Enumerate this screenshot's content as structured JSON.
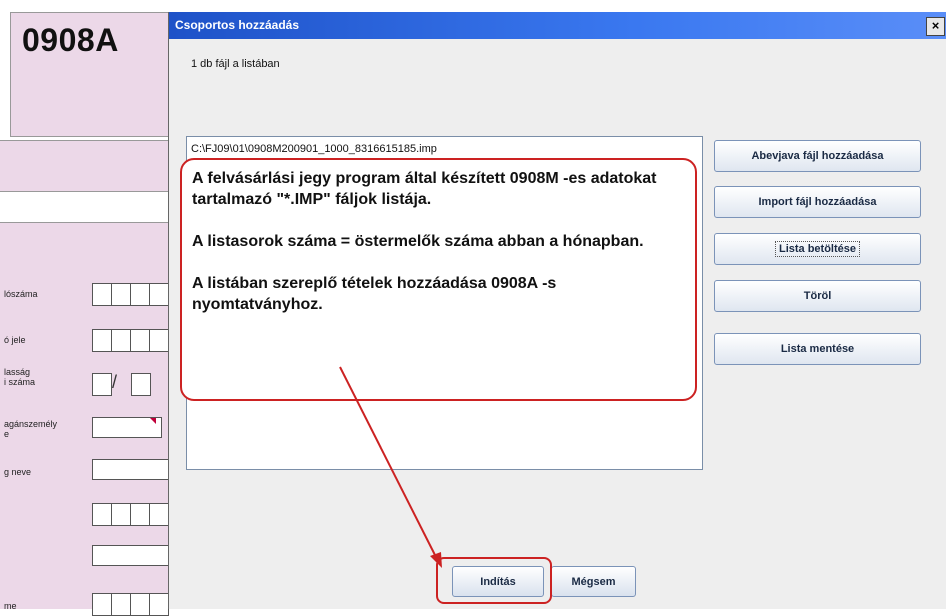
{
  "form": {
    "code": "0908A",
    "labels": [
      "lószáma",
      "ó jele",
      "lasság\ni száma",
      "agánszemély\ne",
      "g neve",
      "me"
    ]
  },
  "dialog": {
    "title": "Csoportos hozzáadás",
    "close_label": "×",
    "file_count": "1 db fájl a listában",
    "list_items": [
      "C:\\FJ09\\01\\0908M200901_1000_8316615185.imp"
    ],
    "buttons": {
      "add_abevjava": "Abevjava fájl hozzáadása",
      "add_import": "Import fájl hozzáadása",
      "load_list": "Lista betöltése",
      "delete": "Töröl",
      "save_list": "Lista mentése",
      "start": "Indítás",
      "cancel": "Mégsem"
    }
  },
  "annotation": {
    "paragraphs": [
      "A felvásárlási jegy program által készített 0908M -es adatokat tartalmazó \"*.IMP\" fáljok listája.",
      "A listasorok száma = östermelők száma abban a hónapban.",
      "A listában szereplő tételek hozzáadása 0908A -s nyomtatványhoz."
    ],
    "color": "#cc2222"
  }
}
